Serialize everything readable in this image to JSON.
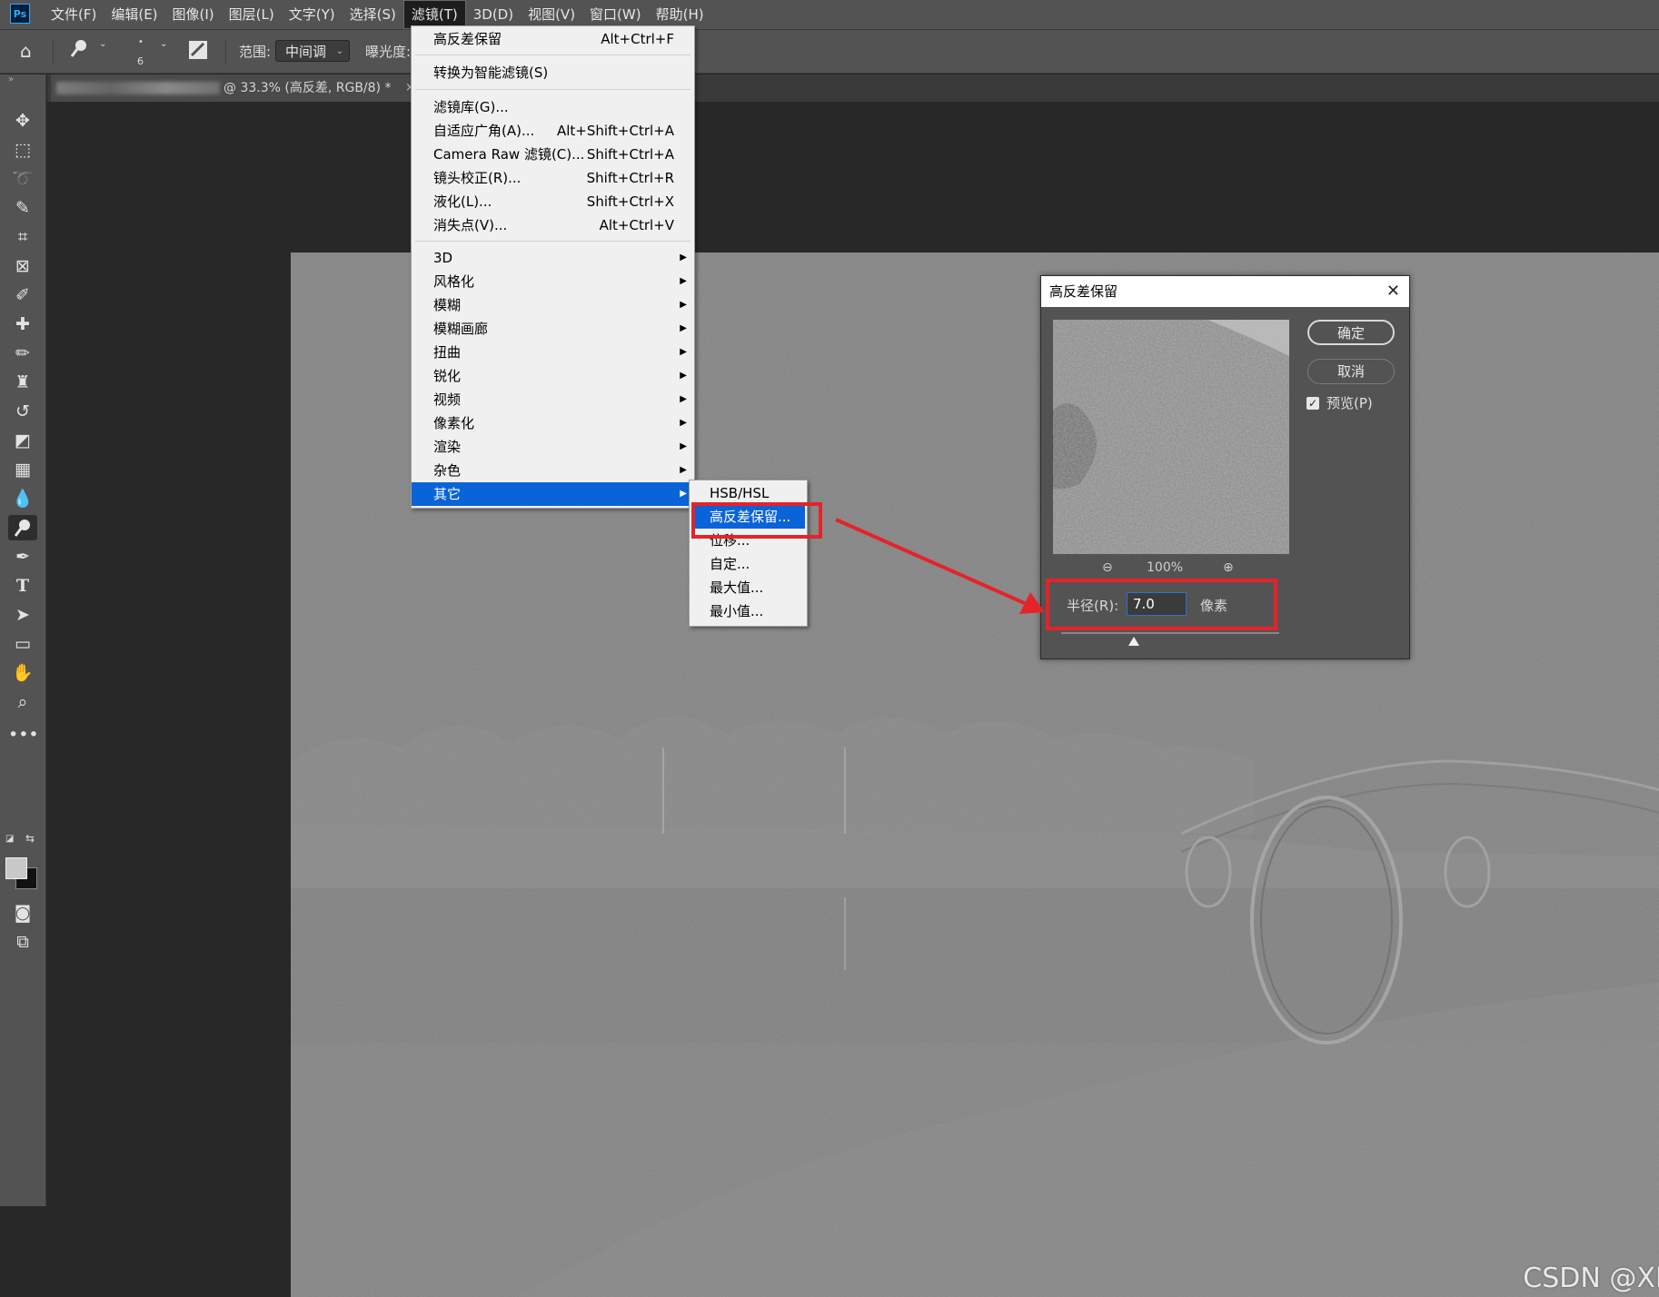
{
  "app": {
    "logo": "Ps"
  },
  "menubar": {
    "items": [
      "文件(F)",
      "编辑(E)",
      "图像(I)",
      "图层(L)",
      "文字(Y)",
      "选择(S)",
      "滤镜(T)",
      "3D(D)",
      "视图(V)",
      "窗口(W)",
      "帮助(H)"
    ],
    "active_index": 6
  },
  "options": {
    "brush_size": "6",
    "range_label": "范围:",
    "range_value": "中间调",
    "exposure_label": "曝光度:"
  },
  "tab": {
    "title": "@ 33.3% (高反差, RGB/8) *",
    "close": "×"
  },
  "filter_menu": {
    "last_filter": {
      "label": "高反差保留",
      "shortcut": "Alt+Ctrl+F"
    },
    "smart": {
      "label": "转换为智能滤镜(S)"
    },
    "gallery_items": [
      {
        "label": "滤镜库(G)...",
        "shortcut": ""
      },
      {
        "label": "自适应广角(A)...",
        "shortcut": "Alt+Shift+Ctrl+A"
      },
      {
        "label": "Camera Raw 滤镜(C)...",
        "shortcut": "Shift+Ctrl+A"
      },
      {
        "label": "镜头校正(R)...",
        "shortcut": "Shift+Ctrl+R"
      },
      {
        "label": "液化(L)...",
        "shortcut": "Shift+Ctrl+X"
      },
      {
        "label": "消失点(V)...",
        "shortcut": "Alt+Ctrl+V"
      }
    ],
    "submenus": [
      "3D",
      "风格化",
      "模糊",
      "模糊画廊",
      "扭曲",
      "锐化",
      "视频",
      "像素化",
      "渲染",
      "杂色",
      "其它"
    ],
    "highlighted": "其它"
  },
  "submenu_other": {
    "items": [
      "HSB/HSL",
      "高反差保留...",
      "位移...",
      "自定...",
      "最大值...",
      "最小值..."
    ],
    "highlighted_index": 1
  },
  "dialog": {
    "title": "高反差保留",
    "close": "✕",
    "ok": "确定",
    "cancel": "取消",
    "preview_label": "预览(P)",
    "preview_checked": true,
    "zoom": "100%",
    "radius_label": "半径(R):",
    "radius_value": "7.0",
    "radius_unit": "像素"
  },
  "watermark": "CSDN @XPii",
  "colors": {
    "menu_highlight": "#0a64d8",
    "annotation_red": "#e6222a",
    "panel_bg": "#535353"
  }
}
